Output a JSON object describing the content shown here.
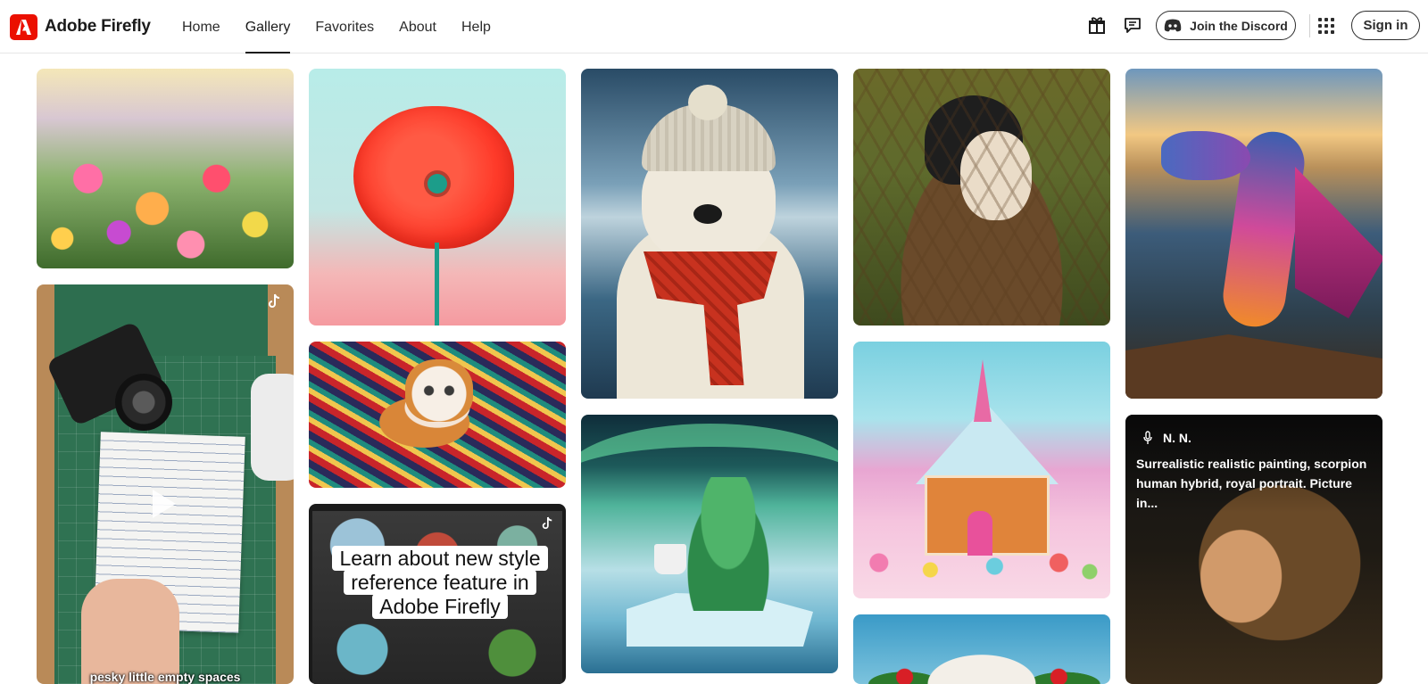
{
  "app": {
    "brand": "Adobe Firefly",
    "accent_color": "#eb1000"
  },
  "nav": {
    "items": [
      {
        "label": "Home",
        "active": false
      },
      {
        "label": "Gallery",
        "active": true
      },
      {
        "label": "Favorites",
        "active": false
      },
      {
        "label": "About",
        "active": false
      },
      {
        "label": "Help",
        "active": false
      }
    ]
  },
  "header_actions": {
    "gift_icon": "gift-icon",
    "feedback_icon": "chat-bubble-icon",
    "discord_label": "Join the Discord",
    "apps_icon": "apps-grid-icon",
    "signin_label": "Sign in"
  },
  "gallery": {
    "craft_video_caption": "pesky little empty spaces",
    "video_card_label": "Learn about new style reference feature in Adobe Firefly",
    "hovered_card": {
      "author": "N. N.",
      "prompt": "Surrealistic realistic painting, scorpion human hybrid, royal portrait. Picture in..."
    }
  }
}
